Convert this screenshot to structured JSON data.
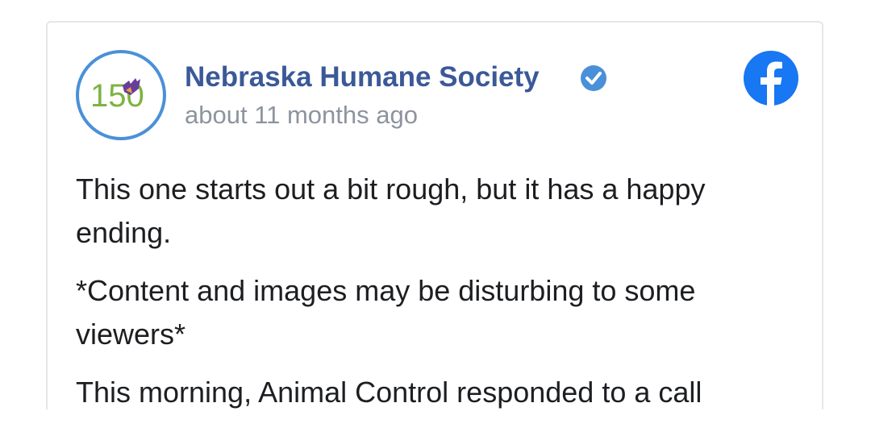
{
  "post": {
    "page_name": "Nebraska Humane Society",
    "timestamp": "about 11 months ago",
    "avatar_text": "150",
    "paragraphs": [
      "This one starts out a bit rough, but it has a happy ending.",
      "*Content and images may be disturbing to some viewers*",
      "This morning, Animal Control responded to a call"
    ]
  },
  "colors": {
    "name": "#3b5998",
    "verified": "#4a90d9",
    "facebook": "#1877f2",
    "timestamp": "#8d949e",
    "avatar_ring": "#4a90d9",
    "avatar_text": "#7cb342",
    "avatar_hand": "#6a3d9a"
  },
  "icons": {
    "verified": "verified-badge-icon",
    "facebook": "facebook-logo-icon"
  }
}
